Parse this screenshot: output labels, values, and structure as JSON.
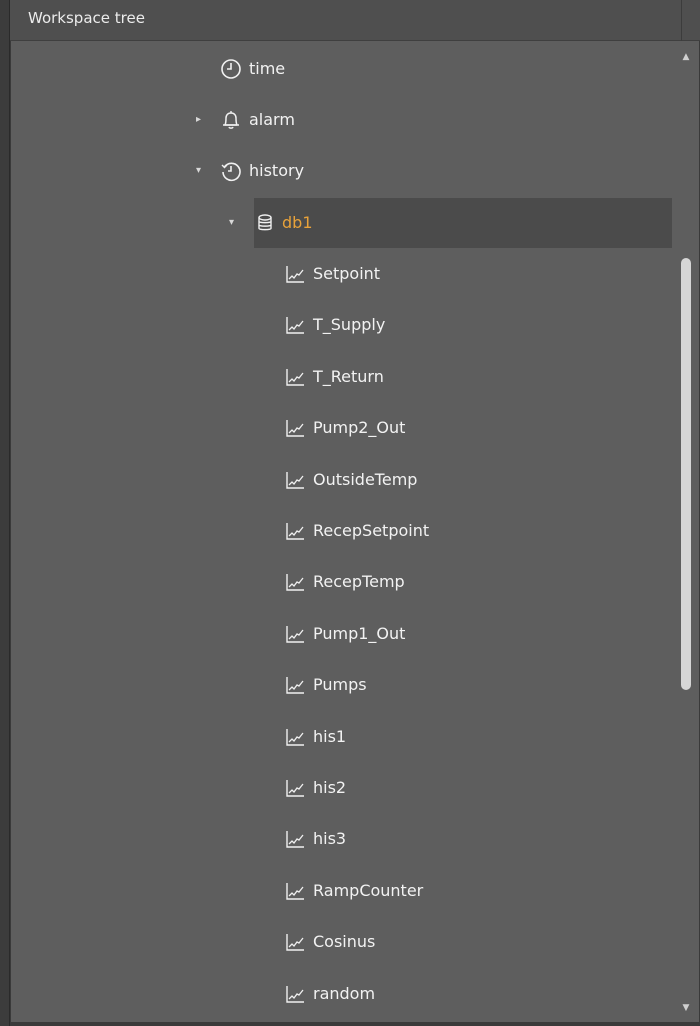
{
  "header": {
    "title": "Workspace tree"
  },
  "tree": {
    "time": {
      "label": "time",
      "icon": "clock-icon"
    },
    "alarm": {
      "label": "alarm",
      "icon": "bell-icon"
    },
    "history": {
      "label": "history",
      "icon": "history-icon"
    },
    "db1": {
      "label": "db1",
      "icon": "database-icon"
    },
    "items": [
      "Setpoint",
      "T_Supply",
      "T_Return",
      "Pump2_Out",
      "OutsideTemp",
      "RecepSetpoint",
      "RecepTemp",
      "Pump1_Out",
      "Pumps",
      "his1",
      "his2",
      "his3",
      "RampCounter",
      "Cosinus",
      "random"
    ]
  },
  "colors": {
    "background": "#5e5e5e",
    "header": "#4f4f4f",
    "selected_row": "#4b4b4b",
    "selected_text": "#e8a23a",
    "text": "#f2f2f2"
  }
}
